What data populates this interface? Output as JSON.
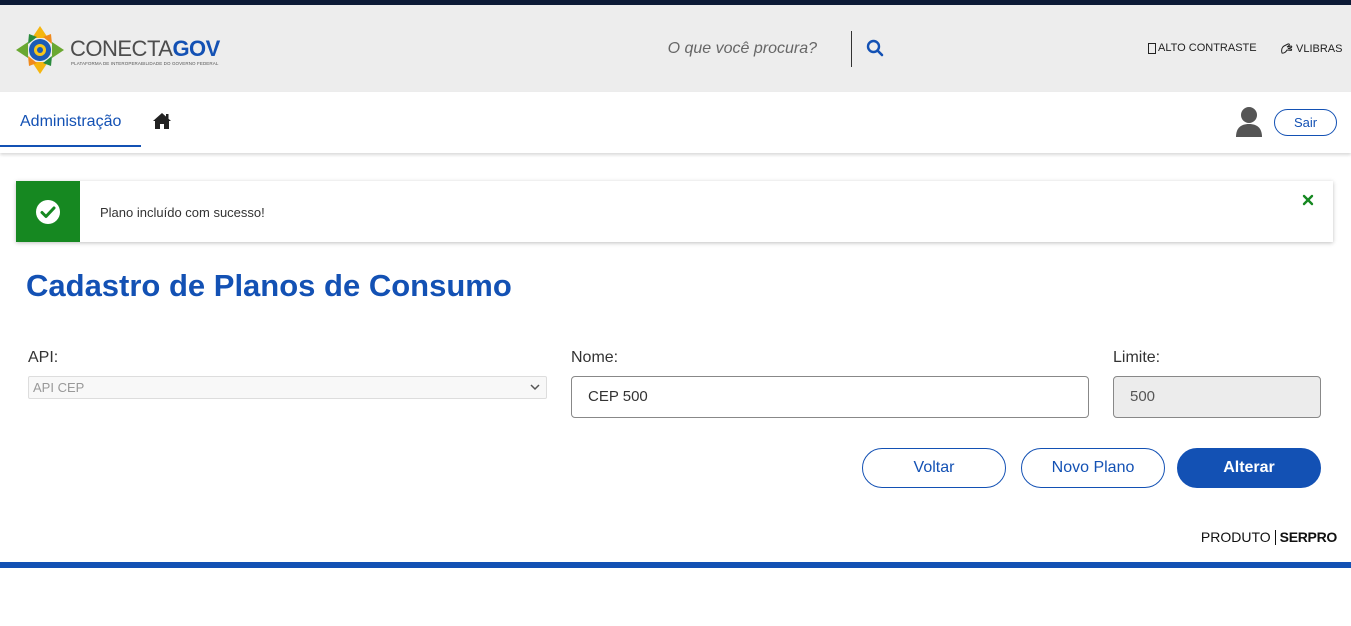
{
  "header": {
    "logo_main": "CONECTA",
    "logo_accent": "GOV",
    "logo_subtitle": "PLATAFORMA DE INTEROPERABILIDADE DO GOVERNO FEDERAL",
    "search_placeholder": "O que você procura?",
    "high_contrast_label": "ALTO CONTRASTE",
    "libras_label": "VLIBRAS"
  },
  "nav": {
    "active_tab": "Administração",
    "logout_label": "Sair"
  },
  "alert": {
    "message": "Plano incluído com sucesso!",
    "type": "success"
  },
  "page": {
    "title": "Cadastro de Planos de Consumo"
  },
  "form": {
    "api_label": "API:",
    "api_value": "API CEP",
    "nome_label": "Nome:",
    "nome_value": "CEP 500",
    "limite_label": "Limite:",
    "limite_value": "500"
  },
  "actions": {
    "voltar": "Voltar",
    "novo_plano": "Novo Plano",
    "alterar": "Alterar"
  },
  "footer": {
    "produto": "PRODUTO",
    "serpro": "SERPRO"
  },
  "colors": {
    "primary": "#1351b4",
    "success": "#168821",
    "header_bg": "#ededed",
    "top_stripe": "#0c1a36"
  }
}
